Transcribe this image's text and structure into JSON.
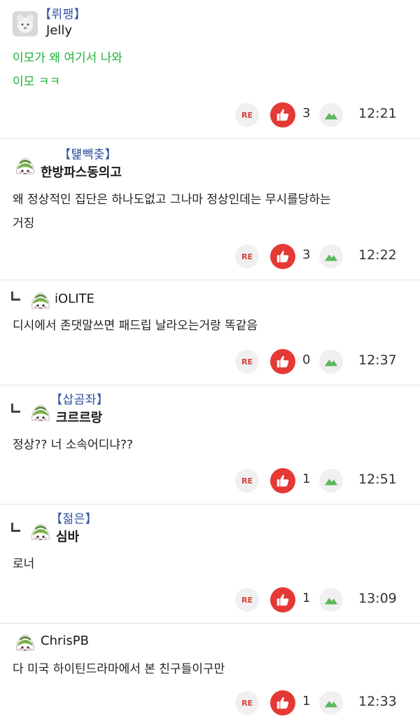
{
  "comments": [
    {
      "guild": "【뤼팽】",
      "nickname": "Jelly",
      "lines": [
        "이모가 왜 여기서 나와",
        "이모 ㅋㅋ"
      ],
      "likes": "3",
      "time": "12:21",
      "re_label": "RE"
    },
    {
      "guild": "【턡빽춫】",
      "nickname": "한방파스동의고",
      "lines": [
        "왜 정상적인 집단은 하나도없고 그나마 정상인데는 무시를당하는",
        "거징"
      ],
      "likes": "3",
      "time": "12:22",
      "re_label": "RE"
    },
    {
      "nickname": "iOLITE",
      "lines": [
        "디시에서 존댓말쓰면 패드립 날라오는거랑 똑같음"
      ],
      "likes": "0",
      "time": "12:37",
      "re_label": "RE"
    },
    {
      "guild": "【삽곰좌】",
      "nickname": "크르르랑",
      "lines": [
        "정상?? 너 소속어디냐??"
      ],
      "likes": "1",
      "time": "12:51",
      "re_label": "RE"
    },
    {
      "guild": "【젊은】",
      "nickname": "심바",
      "lines": [
        "로너"
      ],
      "likes": "1",
      "time": "13:09",
      "re_label": "RE"
    },
    {
      "nickname": "ChrisPB",
      "lines": [
        "다 미국 하이틴드라마에서 본 친구들이구만"
      ],
      "likes": "1",
      "time": "12:33",
      "re_label": "RE"
    }
  ],
  "icons": {
    "reply": "reply-arrow-icon",
    "like": "thumbs-up-icon",
    "mountain": "mountain-icon",
    "avatar": "avatar-icon"
  },
  "colors": {
    "like_red": "#e53935",
    "guild_blue": "#2e4fa0",
    "green_text": "#22b03a",
    "mountain_green": "#5cb85c"
  }
}
